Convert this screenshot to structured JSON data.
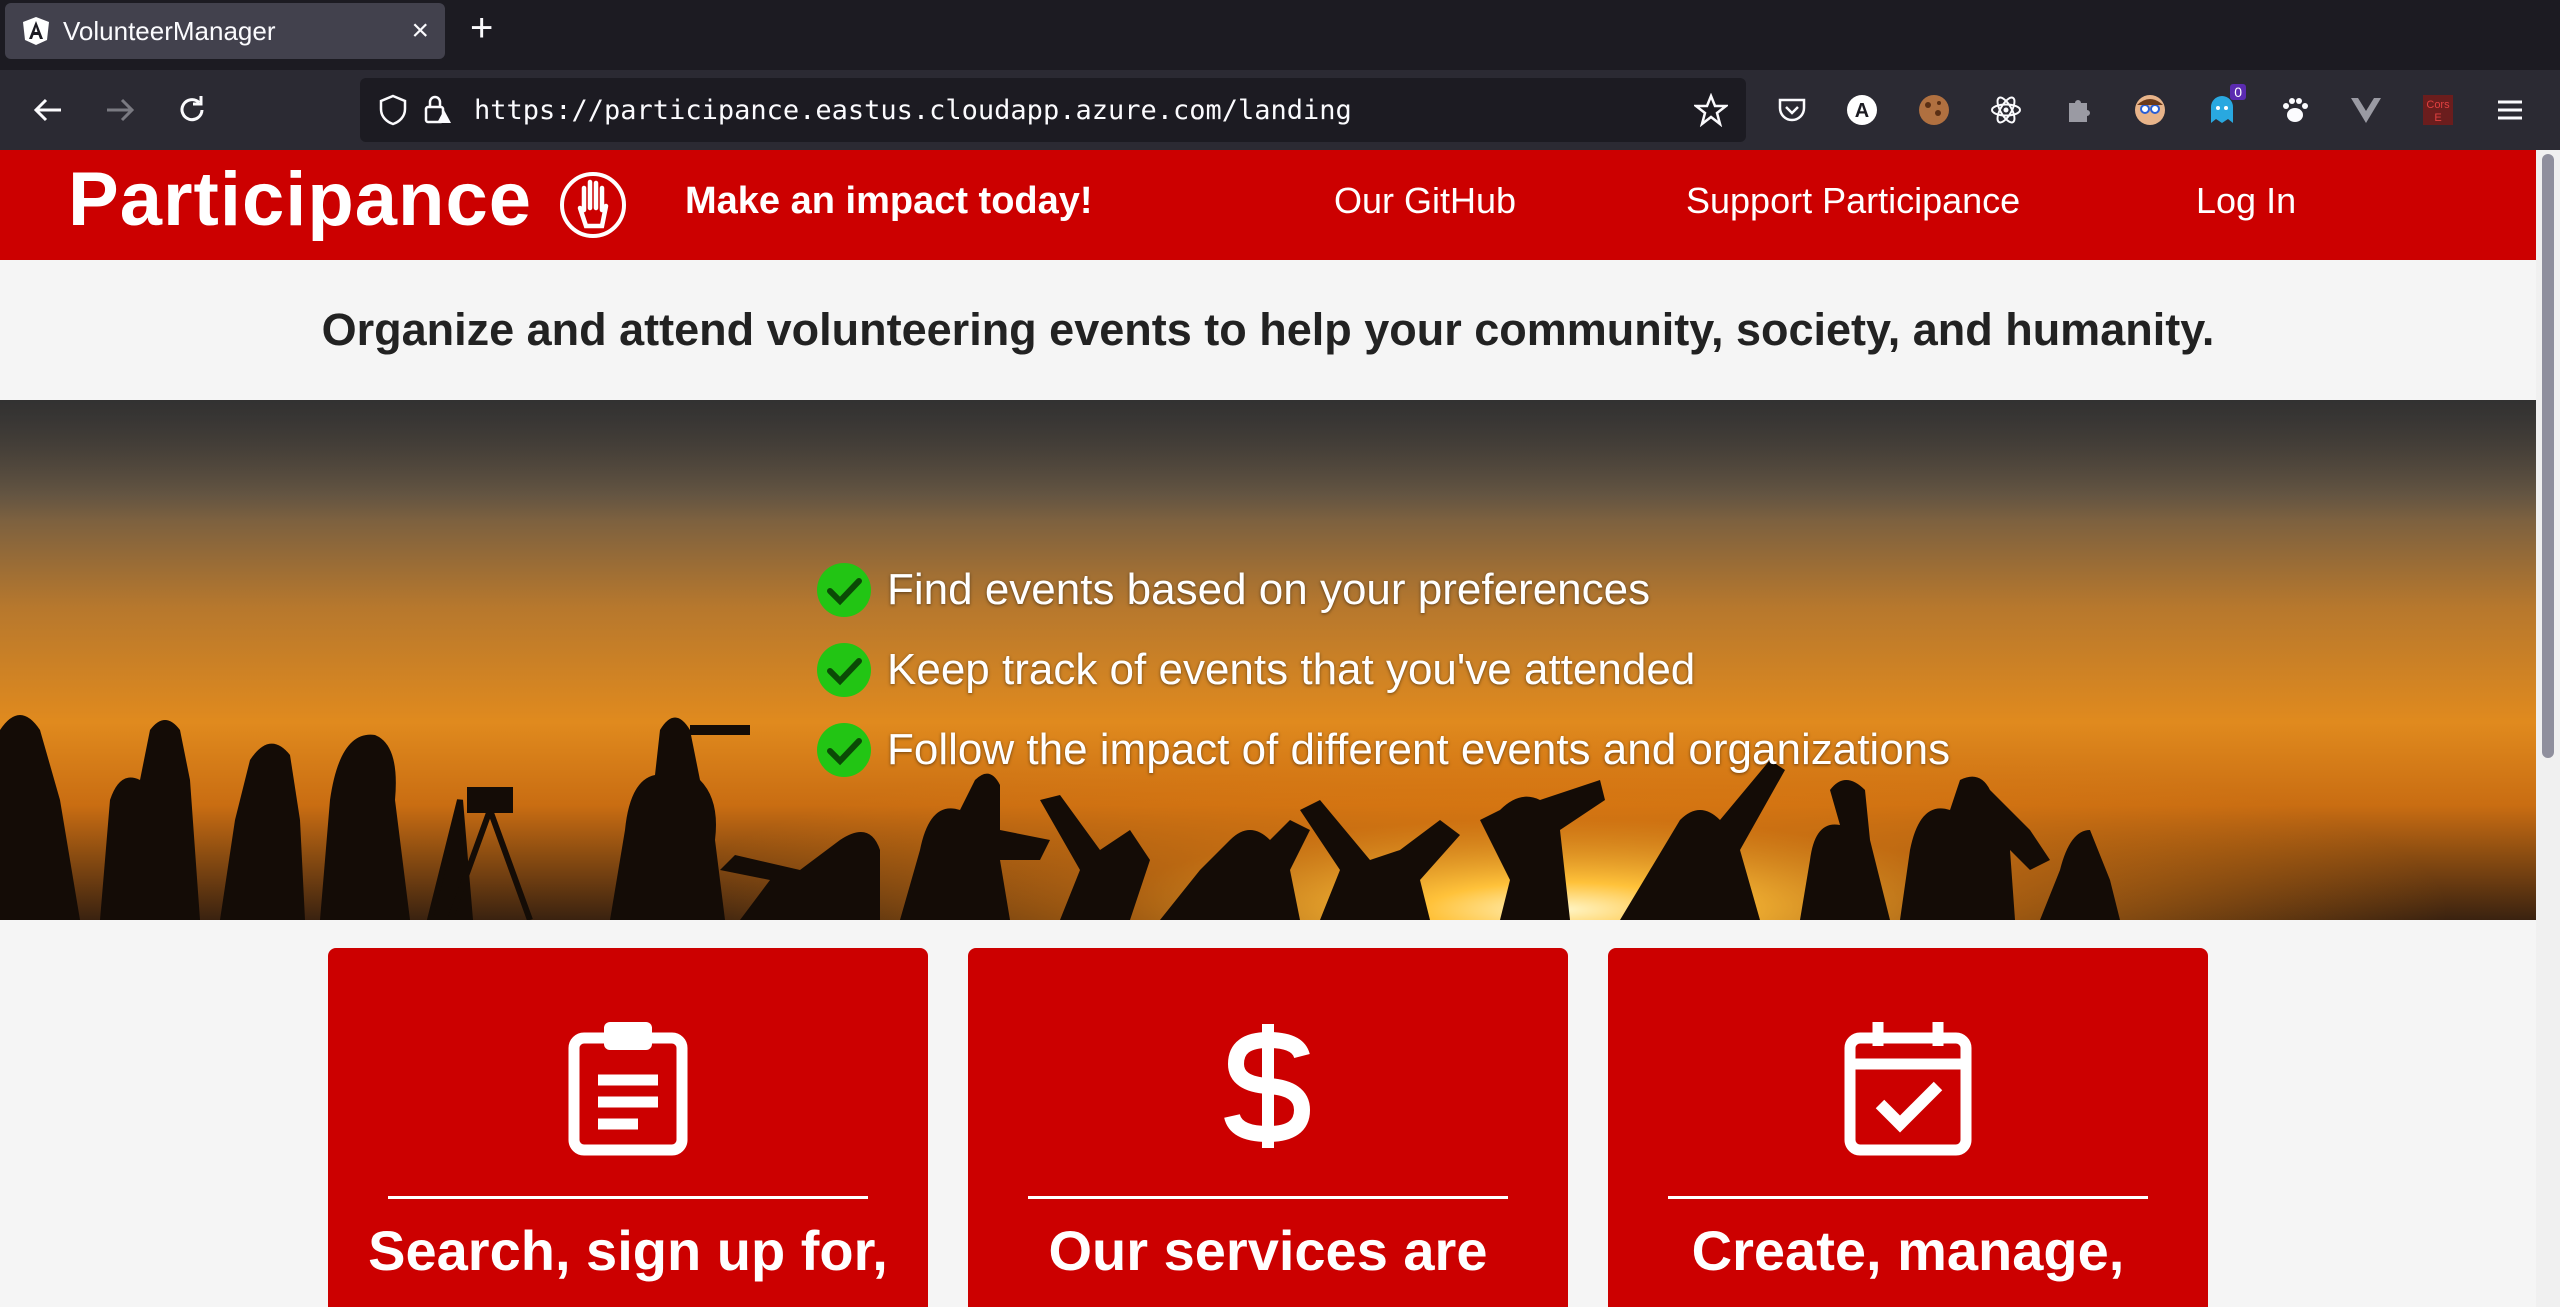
{
  "browser": {
    "tab_title": "VolunteerManager",
    "url": "https://participance.eastus.cloudapp.azure.com/landing",
    "extensions": [
      "ublock-icon",
      "angular-devtools-icon",
      "cookie-icon",
      "react-devtools-icon",
      "puzzle-icon",
      "avatar-icon",
      "ghost-icon",
      "paw-icon",
      "vue-devtools-icon",
      "cors-icon"
    ],
    "ext_badge": "0",
    "cors_label": "Cors E"
  },
  "header": {
    "brand": "Participance",
    "tagline": "Make an impact today!",
    "nav": [
      "Our GitHub",
      "Support Participance",
      "Log In"
    ]
  },
  "intro": {
    "text": "Organize and attend volunteering events to help your community, society, and humanity."
  },
  "hero": {
    "features": [
      "Find events based on your preferences",
      "Keep track of events that you've attended",
      "Follow the impact of different events and organizations"
    ]
  },
  "cards": [
    {
      "icon": "clipboard-icon",
      "text": "Search, sign up for,"
    },
    {
      "icon": "dollar-icon",
      "text": "Our services are"
    },
    {
      "icon": "calendar-check-icon",
      "text": "Create, manage,"
    }
  ],
  "colors": {
    "brand_red": "#cc0000",
    "check_green": "#22c514",
    "chrome_dark": "#1c1b22"
  }
}
